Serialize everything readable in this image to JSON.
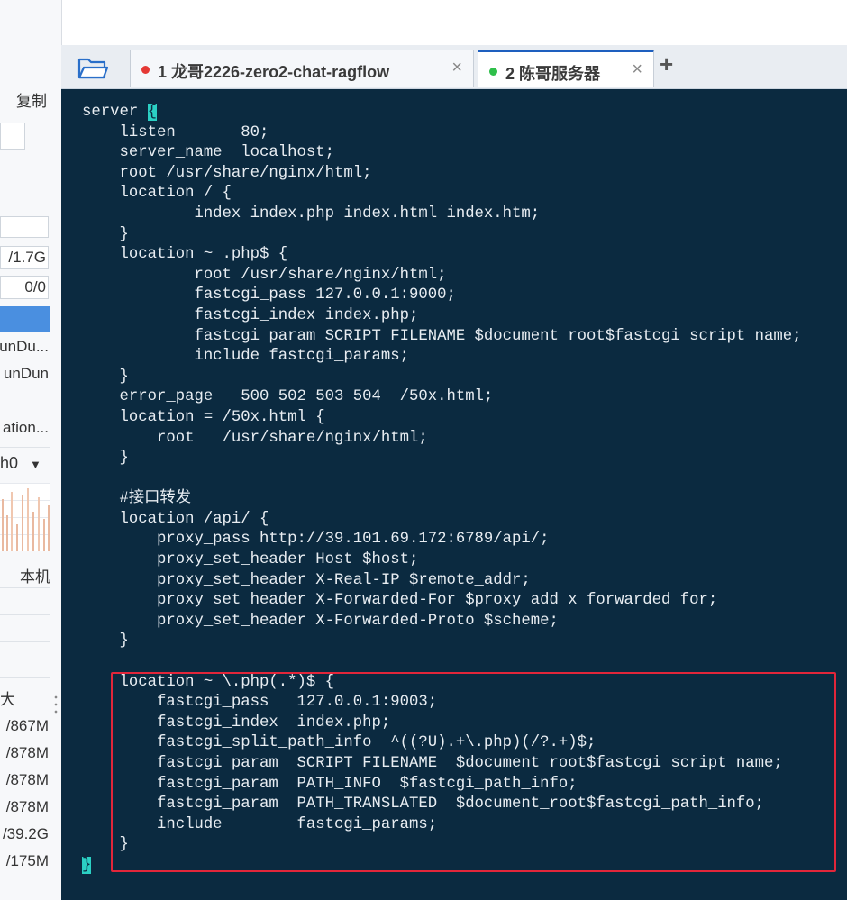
{
  "left_panel": {
    "copy_label": "复制",
    "memory_value": "/1.7G",
    "swap_value": "0/0",
    "process_rows": [
      "unDu...",
      "unDun",
      "ation..."
    ],
    "iface_label": "h0",
    "local_label": "本机",
    "size_header": "大小",
    "sizes": [
      "/867M",
      "/878M",
      "/878M",
      "/878M",
      "/39.2G",
      "/175M"
    ]
  },
  "tabs": [
    {
      "label": "1 龙哥2226-zero2-chat-ragflow",
      "close": "×",
      "dot_color": "#e53935",
      "active": false
    },
    {
      "label": "2 陈哥服务器",
      "close": "×",
      "dot_color": "#2fbf4a",
      "active": true
    }
  ],
  "new_tab": "+",
  "colors": {
    "terminal_bg": "#0b2a40",
    "terminal_text": "#e8edf2",
    "highlight_box": "#e2263a",
    "cursor": "#2bd0c4"
  },
  "terminal": {
    "lines": [
      "server ",
      "    listen       80;",
      "    server_name  localhost;",
      "    root /usr/share/nginx/html;",
      "    location / {",
      "            index index.php index.html index.htm;",
      "    }",
      "    location ~ .php$ {",
      "            root /usr/share/nginx/html;",
      "            fastcgi_pass 127.0.0.1:9000;",
      "            fastcgi_index index.php;",
      "            fastcgi_param SCRIPT_FILENAME $document_root$fastcgi_script_name;",
      "            include fastcgi_params;",
      "    }",
      "    error_page   500 502 503 504  /50x.html;",
      "    location = /50x.html {",
      "        root   /usr/share/nginx/html;",
      "    }",
      "",
      "    #接口转发",
      "    location /api/ {",
      "        proxy_pass http://39.101.69.172:6789/api/;",
      "        proxy_set_header Host $host;",
      "        proxy_set_header X-Real-IP $remote_addr;",
      "        proxy_set_header X-Forwarded-For $proxy_add_x_forwarded_for;",
      "        proxy_set_header X-Forwarded-Proto $scheme;",
      "    }",
      "",
      "    location ~ \\.php(.*)$ {",
      "        fastcgi_pass   127.0.0.1:9003;",
      "        fastcgi_index  index.php;",
      "        fastcgi_split_path_info  ^((?U).+\\.php)(/?.+)$;",
      "        fastcgi_param  SCRIPT_FILENAME  $document_root$fastcgi_script_name;",
      "        fastcgi_param  PATH_INFO  $fastcgi_path_info;",
      "        fastcgi_param  PATH_TRANSLATED  $document_root$fastcgi_path_info;",
      "        include        fastcgi_params;",
      "    }",
      ""
    ],
    "open_brace": "{",
    "close_brace": "}"
  }
}
